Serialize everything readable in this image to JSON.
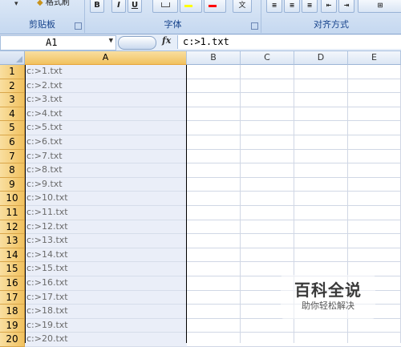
{
  "ribbon": {
    "groups": [
      {
        "label": "剪贴板"
      },
      {
        "label": "字体"
      },
      {
        "label": "对齐方式"
      }
    ],
    "clipboard_partial_label": "格式刷",
    "font_buttons": [
      "B",
      "I",
      "U"
    ],
    "text_color_icon": "A",
    "colors": {
      "highlight": "#ffff00",
      "font": "#ff0000"
    }
  },
  "formula_bar": {
    "name_box": "A1",
    "fx_label": "fx",
    "content": "c:>1.txt"
  },
  "columns": [
    "A",
    "B",
    "C",
    "D",
    "E"
  ],
  "selected_column": "A",
  "rows": [
    {
      "num": "1",
      "a": "c:>1.txt"
    },
    {
      "num": "2",
      "a": "c:>2.txt"
    },
    {
      "num": "3",
      "a": "c:>3.txt"
    },
    {
      "num": "4",
      "a": "c:>4.txt"
    },
    {
      "num": "5",
      "a": "c:>5.txt"
    },
    {
      "num": "6",
      "a": "c:>6.txt"
    },
    {
      "num": "7",
      "a": "c:>7.txt"
    },
    {
      "num": "8",
      "a": "c:>8.txt"
    },
    {
      "num": "9",
      "a": "c:>9.txt"
    },
    {
      "num": "10",
      "a": "c:>10.txt"
    },
    {
      "num": "11",
      "a": "c:>11.txt"
    },
    {
      "num": "12",
      "a": "c:>12.txt"
    },
    {
      "num": "13",
      "a": "c:>13.txt"
    },
    {
      "num": "14",
      "a": "c:>14.txt"
    },
    {
      "num": "15",
      "a": "c:>15.txt"
    },
    {
      "num": "16",
      "a": "c:>16.txt"
    },
    {
      "num": "17",
      "a": "c:>17.txt"
    },
    {
      "num": "18",
      "a": "c:>18.txt"
    },
    {
      "num": "19",
      "a": "c:>19.txt"
    },
    {
      "num": "20",
      "a": "c:>20.txt"
    }
  ],
  "watermark": {
    "title": "百科全说",
    "subtitle": "助你轻松解决"
  }
}
